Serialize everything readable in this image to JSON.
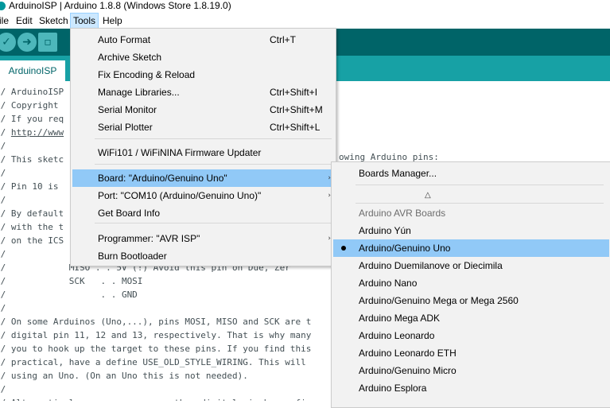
{
  "window": {
    "title": "ArduinoISP | Arduino 1.8.8 (Windows Store 1.8.19.0)"
  },
  "menubar": {
    "file": "ile",
    "edit": "Edit",
    "sketch": "Sketch",
    "tools": "Tools",
    "help": "Help"
  },
  "toolbar": {
    "verify_icon": "check-icon",
    "upload_icon": "arrow-right-icon",
    "new_icon": "new-file-icon"
  },
  "tab": {
    "name": "ArduinoISP"
  },
  "colors": {
    "toolbar": "#006468",
    "tabbar": "#17a1a5",
    "highlight": "#91c9f7",
    "menu_bg": "#f2f2f2"
  },
  "editor": {
    "lines": [
      "// ArduinoISP",
      "// Copyright",
      "// If you req",
      "// ",
      "//",
      "// This sketc",
      "//",
      "// Pin 10 is",
      "//",
      "// By default",
      "// with the t",
      "// on the ICS",
      "//",
      "//            MISO . . 5V (!) Avoid this pin on Due, Zer",
      "//            SCK   . . MOSI",
      "//                  . . GND",
      "//",
      "// On some Arduinos (Uno,...), pins MOSI, MISO and SCK are t",
      "// digital pin 11, 12 and 13, respectively. That is why many",
      "// you to hook up the target to these pins. If you find this",
      "// practical, have a define USE_OLD_STYLE_WIRING. This will",
      "// using an Uno. (On an Uno this is not needed).",
      "//",
      "// Alternatively you can use any other digital pin by config"
    ],
    "link_text": "http://www",
    "overflow_right": "owing Arduino pins:"
  },
  "tools_menu": {
    "items": [
      {
        "label": "Auto Format",
        "shortcut": "Ctrl+T"
      },
      {
        "label": "Archive Sketch",
        "shortcut": ""
      },
      {
        "label": "Fix Encoding & Reload",
        "shortcut": ""
      },
      {
        "label": "Manage Libraries...",
        "shortcut": "Ctrl+Shift+I"
      },
      {
        "label": "Serial Monitor",
        "shortcut": "Ctrl+Shift+M"
      },
      {
        "label": "Serial Plotter",
        "shortcut": "Ctrl+Shift+L"
      },
      {
        "label": "WiFi101 / WiFiNINA Firmware Updater",
        "shortcut": ""
      },
      {
        "label": "Board: \"Arduino/Genuino Uno\"",
        "shortcut": ""
      },
      {
        "label": "Port: \"COM10 (Arduino/Genuino Uno)\"",
        "shortcut": ""
      },
      {
        "label": "Get Board Info",
        "shortcut": ""
      },
      {
        "label": "Programmer: \"AVR ISP\"",
        "shortcut": ""
      },
      {
        "label": "Burn Bootloader",
        "shortcut": ""
      }
    ],
    "submenu_arrow": "›"
  },
  "board_submenu": {
    "manager": "Boards Manager...",
    "scroll_up": "△",
    "section": "Arduino AVR Boards",
    "boards": [
      "Arduino Yún",
      "Arduino/Genuino Uno",
      "Arduino Duemilanove or Diecimila",
      "Arduino Nano",
      "Arduino/Genuino Mega or Mega 2560",
      "Arduino Mega ADK",
      "Arduino Leonardo",
      "Arduino Leonardo ETH",
      "Arduino/Genuino Micro",
      "Arduino Esplora"
    ],
    "selected": "Arduino/Genuino Uno"
  }
}
